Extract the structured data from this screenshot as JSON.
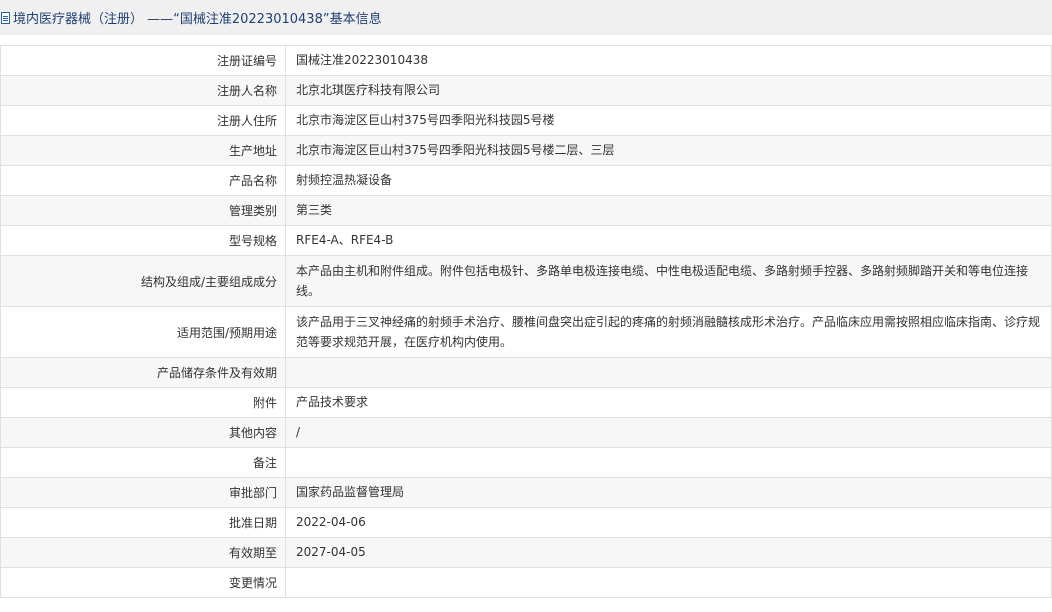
{
  "header": {
    "title": "境内医疗器械（注册） ——“国械注准20223010438”基本信息"
  },
  "rows": [
    {
      "label": "注册证编号",
      "value": "国械注准20223010438"
    },
    {
      "label": "注册人名称",
      "value": "北京北琪医疗科技有限公司"
    },
    {
      "label": "注册人住所",
      "value": "北京市海淀区巨山村375号四季阳光科技园5号楼"
    },
    {
      "label": "生产地址",
      "value": "北京市海淀区巨山村375号四季阳光科技园5号楼二层、三层"
    },
    {
      "label": "产品名称",
      "value": "射频控温热凝设备"
    },
    {
      "label": "管理类别",
      "value": "第三类"
    },
    {
      "label": "型号规格",
      "value": "RFE4-A、RFE4-B"
    },
    {
      "label": "结构及组成/主要组成成分",
      "value": "本产品由主机和附件组成。附件包括电极针、多路单电极连接电缆、中性电极适配电缆、多路射频手控器、多路射频脚踏开关和等电位连接线。"
    },
    {
      "label": "适用范围/预期用途",
      "value": "该产品用于三叉神经痛的射频手术治疗、腰椎间盘突出症引起的疼痛的射频消融髓核成形术治疗。产品临床应用需按照相应临床指南、诊疗规范等要求规范开展，在医疗机构内使用。"
    },
    {
      "label": "产品储存条件及有效期",
      "value": ""
    },
    {
      "label": "附件",
      "value": "产品技术要求"
    },
    {
      "label": "其他内容",
      "value": "/"
    },
    {
      "label": "备注",
      "value": ""
    },
    {
      "label": "审批部门",
      "value": "国家药品监督管理局"
    },
    {
      "label": "批准日期",
      "value": "2022-04-06"
    },
    {
      "label": "有效期至",
      "value": "2027-04-05"
    },
    {
      "label": "变更情况",
      "value": ""
    }
  ]
}
